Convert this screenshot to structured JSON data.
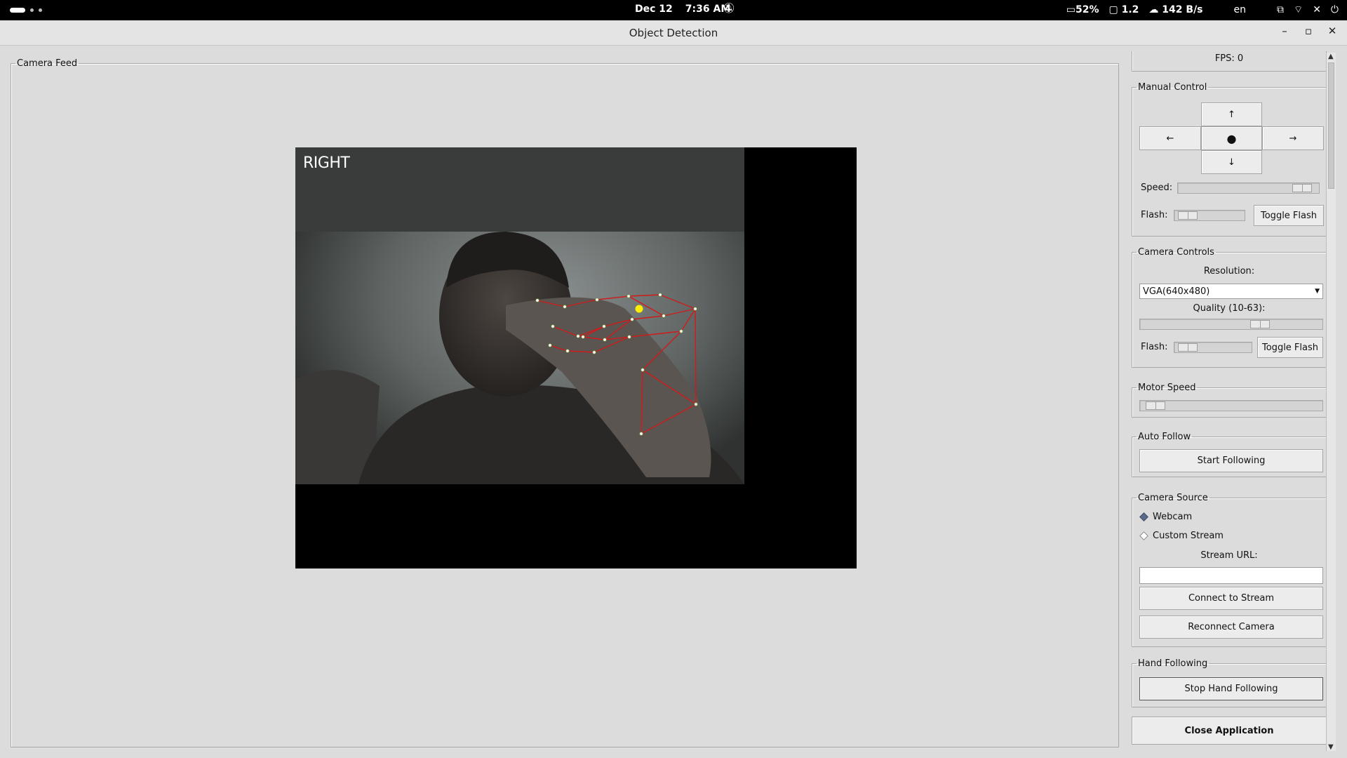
{
  "topbar": {
    "date": "Dec 12",
    "time": "7:36 AM",
    "battery": "52%",
    "display": "1.2",
    "network_rate": "142 B/s",
    "language": "en"
  },
  "window": {
    "title": "Object Detection"
  },
  "camera_feed": {
    "legend": "Camera Feed",
    "overlay_label": "RIGHT"
  },
  "panel": {
    "fps": "FPS: 0",
    "manual_control": {
      "legend": "Manual Control",
      "up": "↑",
      "left": "←",
      "stop": "●",
      "right": "→",
      "down": "↓",
      "speed_label": "Speed:",
      "speed_value": 0.95,
      "flash_label": "Flash:",
      "flash_value": 0.05,
      "toggle_flash": "Toggle Flash"
    },
    "camera_controls": {
      "legend": "Camera Controls",
      "resolution_label": "Resolution:",
      "resolution_value": "VGA(640x480)",
      "quality_label": "Quality (10-63):",
      "quality_value": 0.68,
      "flash_label": "Flash:",
      "flash_value": 0.05,
      "toggle_flash": "Toggle Flash"
    },
    "motor_speed": {
      "legend": "Motor Speed",
      "value": 0.03
    },
    "auto_follow": {
      "legend": "Auto Follow",
      "button": "Start Following"
    },
    "camera_source": {
      "legend": "Camera Source",
      "options": [
        "Webcam",
        "Custom Stream"
      ],
      "selected": "Webcam",
      "stream_url_label": "Stream URL:",
      "stream_url_value": "",
      "connect": "Connect to Stream",
      "reconnect": "Reconnect Camera"
    },
    "hand_following": {
      "legend": "Hand Following",
      "button": "Stop Hand Following"
    },
    "close": "Close Application"
  },
  "colors": {
    "landmark_line": "#d11a1a",
    "landmark_point": "#ffffff",
    "fingertip_highlight": "#ffee00"
  }
}
